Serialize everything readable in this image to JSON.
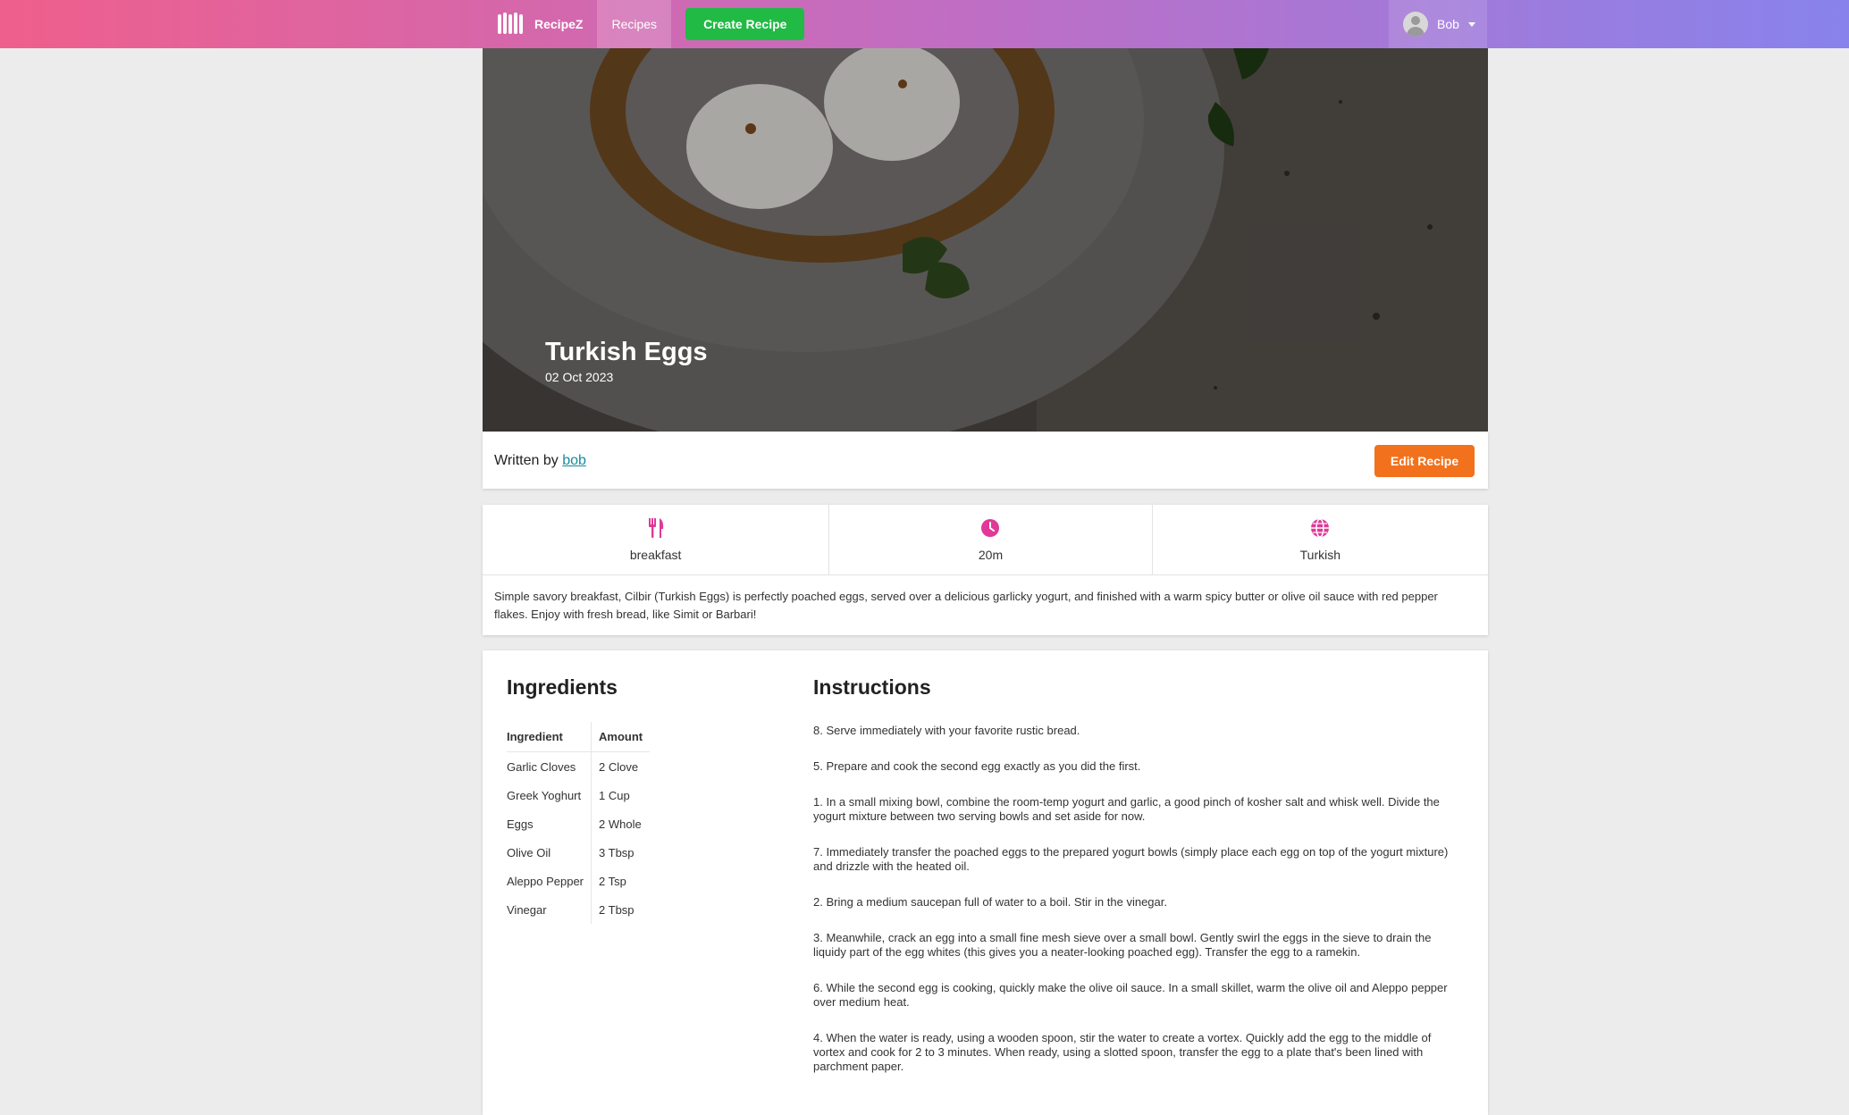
{
  "nav": {
    "brand": "RecipeZ",
    "recipes": "Recipes",
    "create": "Create Recipe",
    "user": "Bob"
  },
  "recipe": {
    "title": "Turkish Eggs",
    "date": "02 Oct 2023",
    "written_by": "Written by",
    "author": "bob",
    "edit": "Edit Recipe",
    "category": "breakfast",
    "time": "20m",
    "cuisine": "Turkish",
    "description": "Simple savory breakfast, Cilbir (Turkish Eggs) is perfectly poached eggs, served over a delicious garlicky yogurt, and finished with a warm spicy butter or olive oil sauce with red pepper flakes. Enjoy with fresh bread, like Simit or Barbari!"
  },
  "ingredients": {
    "heading": "Ingredients",
    "col_ingredient": "Ingredient",
    "col_amount": "Amount",
    "rows": [
      {
        "name": "Garlic Cloves",
        "amount": "2 Clove"
      },
      {
        "name": "Greek Yoghurt",
        "amount": "1 Cup"
      },
      {
        "name": "Eggs",
        "amount": "2 Whole"
      },
      {
        "name": "Olive Oil",
        "amount": "3 Tbsp"
      },
      {
        "name": "Aleppo Pepper",
        "amount": "2 Tsp"
      },
      {
        "name": "Vinegar",
        "amount": "2 Tbsp"
      }
    ]
  },
  "instructions": {
    "heading": "Instructions",
    "steps": [
      "8. Serve immediately with your favorite rustic bread.",
      "5. Prepare and cook the second egg exactly as you did the first.",
      "1. In a small mixing bowl, combine the room-temp yogurt and garlic, a good pinch of kosher salt and whisk well. Divide the yogurt mixture between two serving bowls and set aside for now.",
      "7. Immediately transfer the poached eggs to the prepared yogurt bowls (simply place each egg on top of the yogurt mixture) and drizzle with the heated oil.",
      "2. Bring a medium saucepan full of water to a boil. Stir in the vinegar.",
      "3. Meanwhile, crack an egg into a small fine mesh sieve over a small bowl. Gently swirl the eggs in the sieve to drain the liquidy part of the egg whites (this gives you a neater-looking poached egg). Transfer the egg to a ramekin.",
      "6. While the second egg is cooking, quickly make the olive oil sauce. In a small skillet, warm the olive oil and Aleppo pepper over medium heat.",
      "4. When the water is ready, using a wooden spoon, stir the water to create a vortex. Quickly add the egg to the middle of vortex and cook for 2 to 3 minutes. When ready, using a slotted spoon, transfer the egg to a plate that's been lined with parchment paper."
    ]
  },
  "colors": {
    "accent_pink": "#e03997",
    "create_green": "#21ba45",
    "edit_orange": "#f2711c",
    "link_teal": "#1a8a9a"
  }
}
